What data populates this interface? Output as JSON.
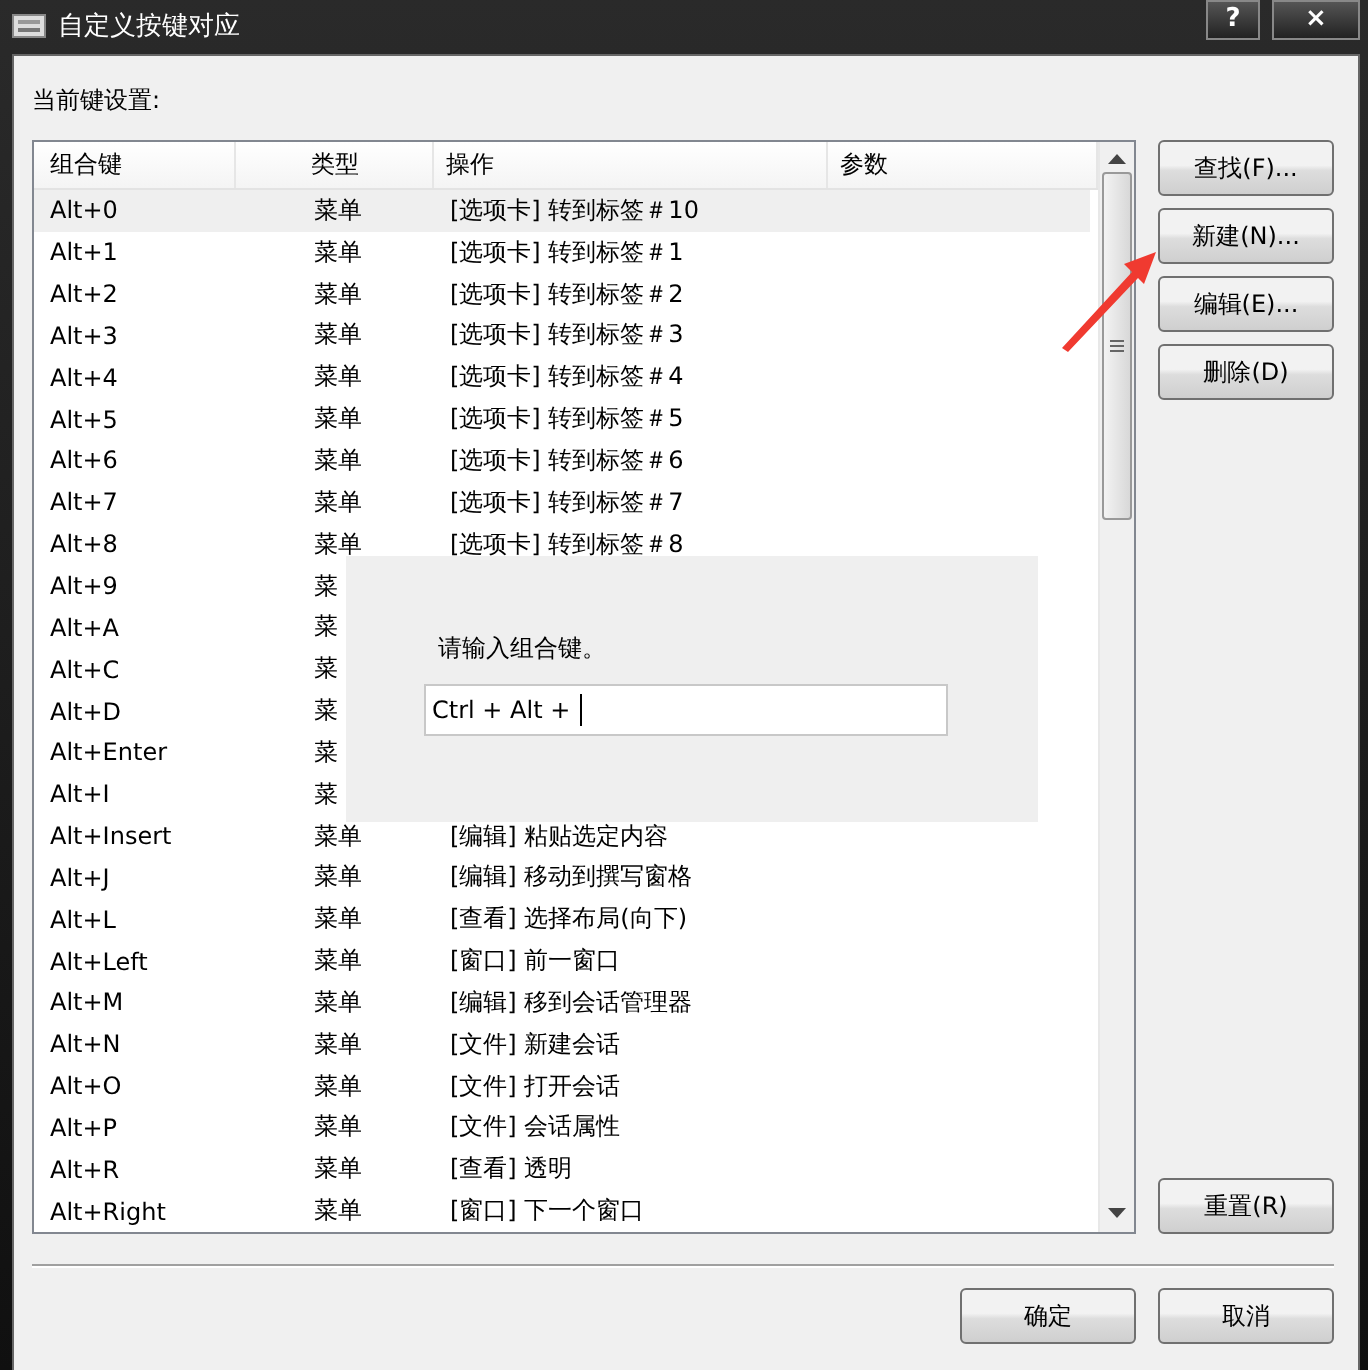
{
  "window": {
    "title": "自定义按键对应",
    "help_button": "?",
    "close_button": "×"
  },
  "section_label": "当前键设置:",
  "table": {
    "columns": [
      "组合键",
      "类型",
      "操作",
      "参数"
    ],
    "rows": [
      {
        "key": "Alt+0",
        "type": "菜单",
        "action": "[选项卡] 转到标签＃10",
        "selected": true
      },
      {
        "key": "Alt+1",
        "type": "菜单",
        "action": "[选项卡] 转到标签＃1",
        "selected": false
      },
      {
        "key": "Alt+2",
        "type": "菜单",
        "action": "[选项卡] 转到标签＃2",
        "selected": false
      },
      {
        "key": "Alt+3",
        "type": "菜单",
        "action": "[选项卡] 转到标签＃3",
        "selected": false
      },
      {
        "key": "Alt+4",
        "type": "菜单",
        "action": "[选项卡] 转到标签＃4",
        "selected": false
      },
      {
        "key": "Alt+5",
        "type": "菜单",
        "action": "[选项卡] 转到标签＃5",
        "selected": false
      },
      {
        "key": "Alt+6",
        "type": "菜单",
        "action": "[选项卡] 转到标签＃6",
        "selected": false
      },
      {
        "key": "Alt+7",
        "type": "菜单",
        "action": "[选项卡] 转到标签＃7",
        "selected": false
      },
      {
        "key": "Alt+8",
        "type": "菜单",
        "action": "[选项卡] 转到标签＃8",
        "selected": false
      },
      {
        "key": "Alt+9",
        "type": "菜",
        "selected": false
      },
      {
        "key": "Alt+A",
        "type": "菜",
        "selected": false
      },
      {
        "key": "Alt+C",
        "type": "菜",
        "selected": false
      },
      {
        "key": "Alt+D",
        "type": "菜",
        "selected": false
      },
      {
        "key": "Alt+Enter",
        "type": "菜",
        "selected": false
      },
      {
        "key": "Alt+I",
        "type": "菜",
        "selected": false
      },
      {
        "key": "Alt+Insert",
        "type": "菜单",
        "action": "[编辑] 粘贴选定内容",
        "selected": false
      },
      {
        "key": "Alt+J",
        "type": "菜单",
        "action": "[编辑] 移动到撰写窗格",
        "selected": false
      },
      {
        "key": "Alt+L",
        "type": "菜单",
        "action": "[查看] 选择布局(向下)",
        "selected": false
      },
      {
        "key": "Alt+Left",
        "type": "菜单",
        "action": "[窗口] 前一窗口",
        "selected": false
      },
      {
        "key": "Alt+M",
        "type": "菜单",
        "action": "[编辑] 移到会话管理器",
        "selected": false
      },
      {
        "key": "Alt+N",
        "type": "菜单",
        "action": "[文件] 新建会话",
        "selected": false
      },
      {
        "key": "Alt+O",
        "type": "菜单",
        "action": "[文件] 打开会话",
        "selected": false
      },
      {
        "key": "Alt+P",
        "type": "菜单",
        "action": "[文件] 会话属性",
        "selected": false
      },
      {
        "key": "Alt+R",
        "type": "菜单",
        "action": "[查看] 透明",
        "selected": false
      },
      {
        "key": "Alt+Right",
        "type": "菜单",
        "action": "[窗口] 下一个窗口",
        "selected": false
      }
    ]
  },
  "side_buttons": [
    "查找(F)...",
    "新建(N)...",
    "编辑(E)...",
    "删除(D)"
  ],
  "reset_button": "重置(R)",
  "key_prompt": {
    "label": "请输入组合键。",
    "value": "Ctrl + Alt +"
  },
  "footer_buttons": [
    "确定",
    "取消"
  ]
}
